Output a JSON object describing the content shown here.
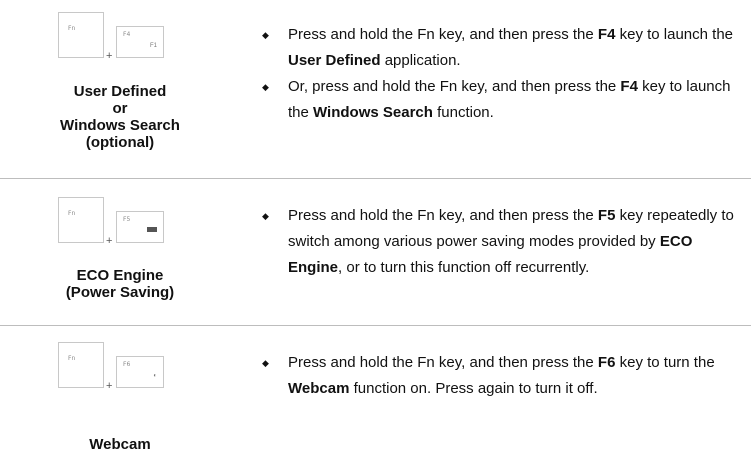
{
  "rows": [
    {
      "fn_key": "Fn",
      "f_key": "F4",
      "f_key_icon": "F1",
      "plus": "+",
      "caption": [
        "User Defined",
        "or",
        "Windows Search",
        "(optional)"
      ],
      "bullets": [
        [
          {
            "t": "Press and hold the Fn key, and then press the "
          },
          {
            "t": "F4",
            "b": true
          },
          {
            "t": " key to launch the "
          },
          {
            "t": "User Defined",
            "b": true
          },
          {
            "t": " application."
          }
        ],
        [
          {
            "t": "Or, press and hold the Fn key, and then press the "
          },
          {
            "t": "F4",
            "b": true
          },
          {
            "t": " key to launch the "
          },
          {
            "t": "Windows Search",
            "b": true
          },
          {
            "t": " function."
          }
        ]
      ]
    },
    {
      "fn_key": "Fn",
      "f_key": "F5",
      "f_key_icon": "battery-icon",
      "plus": "+",
      "caption": [
        "ECO Engine",
        "(Power Saving)"
      ],
      "bullets": [
        [
          {
            "t": "Press and hold the Fn key, and then press the "
          },
          {
            "t": "F5",
            "b": true
          },
          {
            "t": " key repeatedly to switch among various power saving modes provided by "
          },
          {
            "t": "ECO Engine",
            "b": true
          },
          {
            "t": ", or to turn this function off recurrently."
          }
        ]
      ]
    },
    {
      "fn_key": "Fn",
      "f_key": "F6",
      "f_key_icon": "webcam-icon",
      "plus": "+",
      "caption": [
        "Webcam"
      ],
      "bullets": [
        [
          {
            "t": "Press and hold the Fn key, and then press the "
          },
          {
            "t": "F6",
            "b": true
          },
          {
            "t": " key to turn the "
          },
          {
            "t": "Webcam",
            "b": true
          },
          {
            "t": " function on. Press again to turn it off."
          }
        ]
      ]
    }
  ]
}
